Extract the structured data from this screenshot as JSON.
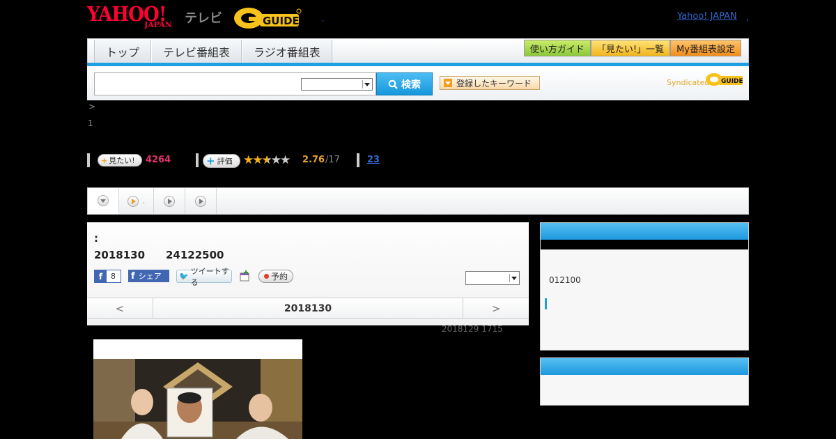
{
  "header": {
    "yahoo_logo": "YAHOO!",
    "yahoo_sub": "JAPAN",
    "tv_label": "テレビ",
    "yahoo_japan_link": "Yahoo! JAPAN",
    "header_dot": ",",
    "small_dot": ","
  },
  "nav": {
    "tabs": [
      "トップ",
      "テレビ番組表",
      "ラジオ番組表"
    ],
    "guide_btn": "使い方ガイド",
    "watch_btn": "「見たい!」一覧",
    "my_btn": "My番組表設定"
  },
  "search": {
    "button_label": "検索",
    "keyword_btn": "登録したキーワード",
    "syndicated": "Syndicated"
  },
  "breadcrumb": ">",
  "page_num": "1",
  "stats": {
    "mitai_label": "見たい!",
    "mitai_count": "4264",
    "hyoka_label": "評価",
    "rating_stars": 2.76,
    "rating": "2.76",
    "rating_count": "/17",
    "review_link": "23"
  },
  "tabs": {
    "second_dot": "."
  },
  "program": {
    "title": ":",
    "date": "2018130",
    "time": "24122500",
    "fb_like_count": "8",
    "fb_share": "シェア",
    "tweet": "ツイートする",
    "reserve": "予約",
    "day_prev": "<",
    "day_label": "2018130",
    "day_next": ">"
  },
  "updated": "2018129  1715",
  "side": {
    "text": "012100"
  },
  "colors": {
    "accent_blue": "#1e9fe0",
    "mitai_pink": "#e0336a",
    "rating_orange": "#e9a12d",
    "link_blue": "#3366cc"
  }
}
